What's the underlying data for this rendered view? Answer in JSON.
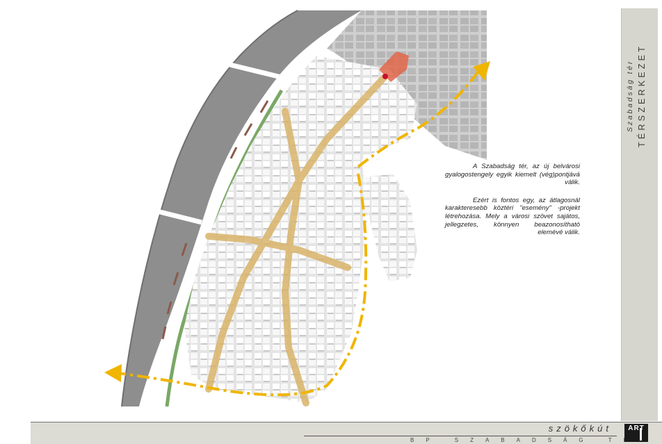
{
  "side_panel": {
    "subtitle": "Szabadság tér",
    "title": "TÉRSZERKEZET"
  },
  "text": {
    "paragraph1": "A Szabadság tér, az új belvárosi gyalogostengely egyik kiemelt (vég)pontjává válik.",
    "paragraph2": "Ezért is fontos egy, az átlagosnál karakteresebb köztéri \"esemény\" -projekt létrehozása. Mely a városi szövet sajátos, jellegzetes, könnyen beazonosítható elemévé válik."
  },
  "footer": {
    "title": "szökőkút",
    "subtitle": "BP SZABADSÁG TÉR",
    "logo_text": "ART"
  },
  "colors": {
    "river": "#8c8c8c",
    "river_edge": "#7d7d7d",
    "embankment": "#6fa05a",
    "blocks": "#f4f4f4",
    "block_shadow": "#cfcfcf",
    "axis": "#d9b46a",
    "arrows": "#f0b500",
    "square": "#e2664a",
    "grid_district": "#b9b9b9"
  },
  "map": {
    "elements": [
      "danube-river",
      "embankment",
      "city-blocks",
      "pedestrian-axis",
      "szabadsag-ter-square",
      "direction-arrows"
    ]
  }
}
